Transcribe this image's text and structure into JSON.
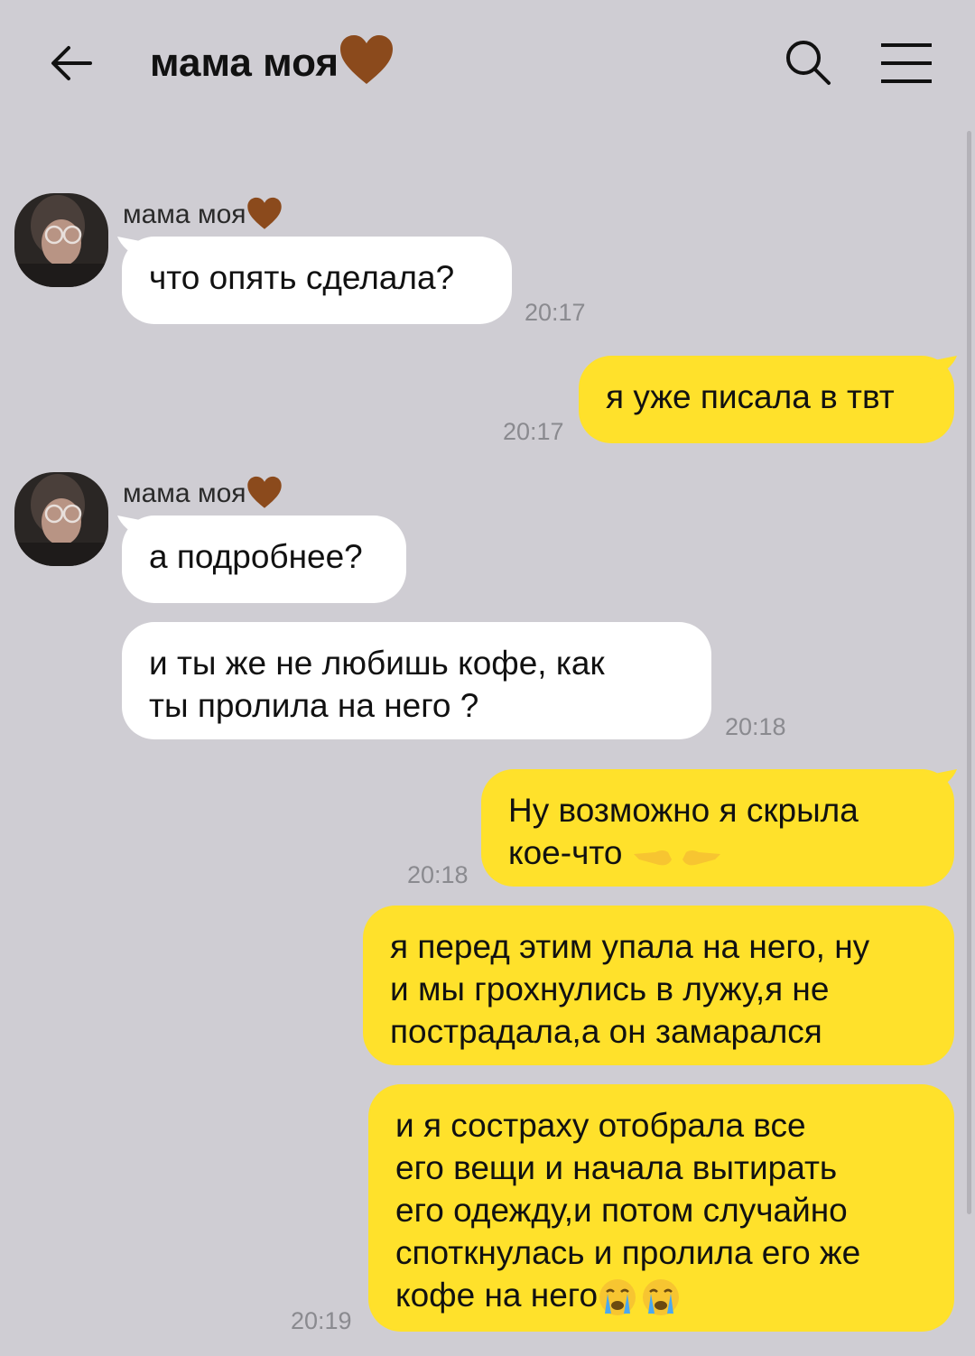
{
  "header": {
    "title": "мама моя"
  },
  "colors": {
    "background": "#cfcdd3",
    "incoming_bubble": "#ffffff",
    "outgoing_bubble": "#ffe12b",
    "heart": "#8b4a1c"
  },
  "icons": [
    "back-arrow-icon",
    "brown-heart-icon",
    "search-icon",
    "menu-icon",
    "pointing-hands-icon",
    "crying-face-icon"
  ],
  "messages": [
    {
      "sender": "мама моя",
      "text": "что опять сделала?",
      "time": "20:17",
      "direction": "incoming"
    },
    {
      "text": "я уже писала в твт",
      "time": "20:17",
      "direction": "outgoing"
    },
    {
      "sender": "мама моя",
      "text": "а подробнее?",
      "direction": "incoming"
    },
    {
      "text_line1": "и ты же не любишь кофе, как",
      "text_line2": "ты пролила на него ?",
      "time": "20:18",
      "direction": "incoming"
    },
    {
      "text_line1": "Ну возможно я скрыла",
      "text_line2": "кое-что",
      "time": "20:18",
      "direction": "outgoing"
    },
    {
      "text_line1": "я перед этим упала на него, ну",
      "text_line2": "и мы грохнулись в лужу,я не",
      "text_line3": "пострадала,а он замарался",
      "direction": "outgoing"
    },
    {
      "text_line1": "и я состраху отобрала все",
      "text_line2": "его вещи и начала вытирать",
      "text_line3": "его одежду,и потом случайно",
      "text_line4": "споткнулась и пролила его же",
      "text_line5": "кофе на него",
      "time": "20:19",
      "direction": "outgoing"
    }
  ]
}
